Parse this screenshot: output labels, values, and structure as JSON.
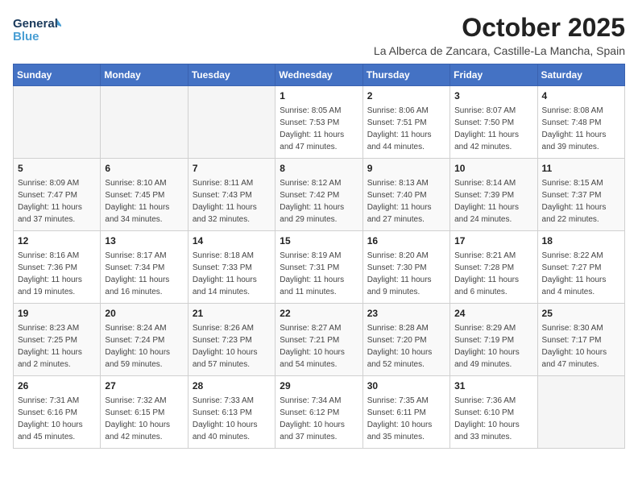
{
  "header": {
    "logo_line1": "General",
    "logo_line2": "Blue",
    "title": "October 2025",
    "location": "La Alberca de Zancara, Castille-La Mancha, Spain"
  },
  "days_of_week": [
    "Sunday",
    "Monday",
    "Tuesday",
    "Wednesday",
    "Thursday",
    "Friday",
    "Saturday"
  ],
  "weeks": [
    [
      {
        "day": "",
        "info": ""
      },
      {
        "day": "",
        "info": ""
      },
      {
        "day": "",
        "info": ""
      },
      {
        "day": "1",
        "info": "Sunrise: 8:05 AM\nSunset: 7:53 PM\nDaylight: 11 hours and 47 minutes."
      },
      {
        "day": "2",
        "info": "Sunrise: 8:06 AM\nSunset: 7:51 PM\nDaylight: 11 hours and 44 minutes."
      },
      {
        "day": "3",
        "info": "Sunrise: 8:07 AM\nSunset: 7:50 PM\nDaylight: 11 hours and 42 minutes."
      },
      {
        "day": "4",
        "info": "Sunrise: 8:08 AM\nSunset: 7:48 PM\nDaylight: 11 hours and 39 minutes."
      }
    ],
    [
      {
        "day": "5",
        "info": "Sunrise: 8:09 AM\nSunset: 7:47 PM\nDaylight: 11 hours and 37 minutes."
      },
      {
        "day": "6",
        "info": "Sunrise: 8:10 AM\nSunset: 7:45 PM\nDaylight: 11 hours and 34 minutes."
      },
      {
        "day": "7",
        "info": "Sunrise: 8:11 AM\nSunset: 7:43 PM\nDaylight: 11 hours and 32 minutes."
      },
      {
        "day": "8",
        "info": "Sunrise: 8:12 AM\nSunset: 7:42 PM\nDaylight: 11 hours and 29 minutes."
      },
      {
        "day": "9",
        "info": "Sunrise: 8:13 AM\nSunset: 7:40 PM\nDaylight: 11 hours and 27 minutes."
      },
      {
        "day": "10",
        "info": "Sunrise: 8:14 AM\nSunset: 7:39 PM\nDaylight: 11 hours and 24 minutes."
      },
      {
        "day": "11",
        "info": "Sunrise: 8:15 AM\nSunset: 7:37 PM\nDaylight: 11 hours and 22 minutes."
      }
    ],
    [
      {
        "day": "12",
        "info": "Sunrise: 8:16 AM\nSunset: 7:36 PM\nDaylight: 11 hours and 19 minutes."
      },
      {
        "day": "13",
        "info": "Sunrise: 8:17 AM\nSunset: 7:34 PM\nDaylight: 11 hours and 16 minutes."
      },
      {
        "day": "14",
        "info": "Sunrise: 8:18 AM\nSunset: 7:33 PM\nDaylight: 11 hours and 14 minutes."
      },
      {
        "day": "15",
        "info": "Sunrise: 8:19 AM\nSunset: 7:31 PM\nDaylight: 11 hours and 11 minutes."
      },
      {
        "day": "16",
        "info": "Sunrise: 8:20 AM\nSunset: 7:30 PM\nDaylight: 11 hours and 9 minutes."
      },
      {
        "day": "17",
        "info": "Sunrise: 8:21 AM\nSunset: 7:28 PM\nDaylight: 11 hours and 6 minutes."
      },
      {
        "day": "18",
        "info": "Sunrise: 8:22 AM\nSunset: 7:27 PM\nDaylight: 11 hours and 4 minutes."
      }
    ],
    [
      {
        "day": "19",
        "info": "Sunrise: 8:23 AM\nSunset: 7:25 PM\nDaylight: 11 hours and 2 minutes."
      },
      {
        "day": "20",
        "info": "Sunrise: 8:24 AM\nSunset: 7:24 PM\nDaylight: 10 hours and 59 minutes."
      },
      {
        "day": "21",
        "info": "Sunrise: 8:26 AM\nSunset: 7:23 PM\nDaylight: 10 hours and 57 minutes."
      },
      {
        "day": "22",
        "info": "Sunrise: 8:27 AM\nSunset: 7:21 PM\nDaylight: 10 hours and 54 minutes."
      },
      {
        "day": "23",
        "info": "Sunrise: 8:28 AM\nSunset: 7:20 PM\nDaylight: 10 hours and 52 minutes."
      },
      {
        "day": "24",
        "info": "Sunrise: 8:29 AM\nSunset: 7:19 PM\nDaylight: 10 hours and 49 minutes."
      },
      {
        "day": "25",
        "info": "Sunrise: 8:30 AM\nSunset: 7:17 PM\nDaylight: 10 hours and 47 minutes."
      }
    ],
    [
      {
        "day": "26",
        "info": "Sunrise: 7:31 AM\nSunset: 6:16 PM\nDaylight: 10 hours and 45 minutes."
      },
      {
        "day": "27",
        "info": "Sunrise: 7:32 AM\nSunset: 6:15 PM\nDaylight: 10 hours and 42 minutes."
      },
      {
        "day": "28",
        "info": "Sunrise: 7:33 AM\nSunset: 6:13 PM\nDaylight: 10 hours and 40 minutes."
      },
      {
        "day": "29",
        "info": "Sunrise: 7:34 AM\nSunset: 6:12 PM\nDaylight: 10 hours and 37 minutes."
      },
      {
        "day": "30",
        "info": "Sunrise: 7:35 AM\nSunset: 6:11 PM\nDaylight: 10 hours and 35 minutes."
      },
      {
        "day": "31",
        "info": "Sunrise: 7:36 AM\nSunset: 6:10 PM\nDaylight: 10 hours and 33 minutes."
      },
      {
        "day": "",
        "info": ""
      }
    ]
  ]
}
